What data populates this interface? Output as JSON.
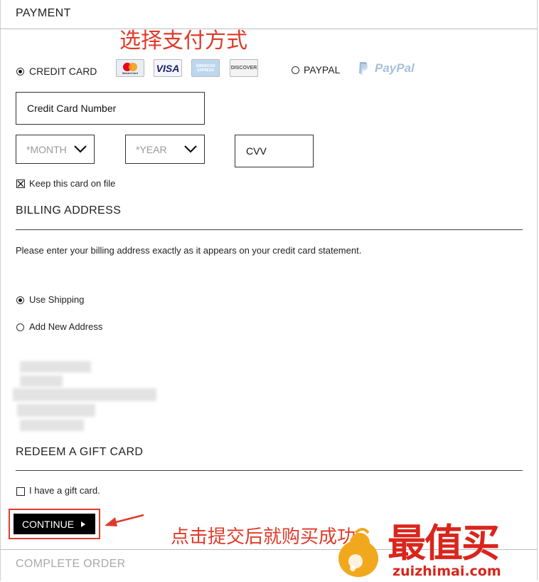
{
  "payment": {
    "section_title": "PAYMENT",
    "annotation_choose": "选择支付方式",
    "credit_card_label": "CREDIT CARD",
    "paypal_label": "PAYPAL",
    "card_logos": [
      "MasterCard",
      "VISA",
      "AMERICAN EXPRESS",
      "DISCOVER"
    ],
    "paypal_logo": "PayPal",
    "card_number_placeholder": "Credit Card Number",
    "month_placeholder": "*MONTH",
    "year_placeholder": "*YEAR",
    "cvv_placeholder": "CVV",
    "keep_card_label": "Keep this card on file",
    "selected_method": "credit_card"
  },
  "billing": {
    "section_title": "BILLING ADDRESS",
    "instruction": "Please enter your billing address exactly as it appears on your credit card statement.",
    "use_shipping_label": "Use Shipping",
    "add_new_label": "Add New Address",
    "selected_option": "use_shipping"
  },
  "gift": {
    "section_title": "REDEEM A GIFT CARD",
    "have_gift_label": "I have a gift card."
  },
  "actions": {
    "continue_label": "CONTINUE",
    "annotation_submit": "点击提交后就购买成功",
    "complete_order_label": "COMPLETE ORDER"
  },
  "watermark": {
    "brand_cn": "最值买",
    "brand_url": "zuizhimai.com"
  },
  "colors": {
    "annotation_red": "#e03a2a",
    "button_bg": "#000000",
    "watermark_red": "#d9251c",
    "watermark_gold": "#f2a81d"
  }
}
